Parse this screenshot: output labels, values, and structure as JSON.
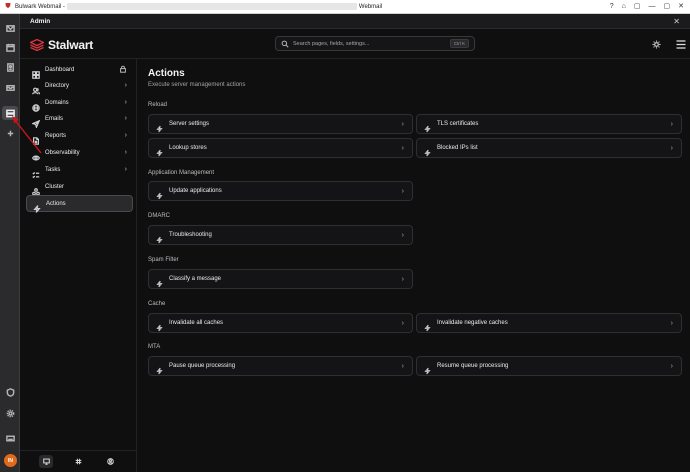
{
  "window": {
    "title_prefix": "Bulwark Webmail -",
    "title_suffix": "Webmail",
    "controls": [
      "?",
      "⌂",
      "▢",
      "—",
      "▢",
      "✕"
    ]
  },
  "admin_bar": {
    "title": "Admin",
    "close": "✕"
  },
  "brand": {
    "name": "Stalwart",
    "color": "#d9363e"
  },
  "search": {
    "placeholder": "Search pages, fields, settings...",
    "shortcut": "Ctrl K"
  },
  "user": {
    "initials": "IN"
  },
  "sidebar": {
    "items": [
      {
        "label": "Dashboard",
        "icon": "dashboard-icon",
        "right": "lock"
      },
      {
        "label": "Directory",
        "icon": "users-icon",
        "right": "›"
      },
      {
        "label": "Domains",
        "icon": "globe-icon",
        "right": "›"
      },
      {
        "label": "Emails",
        "icon": "send-icon",
        "right": "›"
      },
      {
        "label": "Reports",
        "icon": "file-icon",
        "right": "›"
      },
      {
        "label": "Observability",
        "icon": "eye-icon",
        "right": "›"
      },
      {
        "label": "Tasks",
        "icon": "list-check-icon",
        "right": "›"
      },
      {
        "label": "Cluster",
        "icon": "cluster-icon",
        "right": ""
      },
      {
        "label": "Actions",
        "icon": "bolt-icon",
        "right": "",
        "active": true
      }
    ]
  },
  "main": {
    "title": "Actions",
    "subtitle": "Execute server management actions",
    "sections": [
      {
        "title": "Reload",
        "actions": [
          "Server settings",
          "TLS certificates",
          "Lookup stores",
          "Blocked IPs list"
        ]
      },
      {
        "title": "Application Management",
        "actions": [
          "Update applications"
        ]
      },
      {
        "title": "DMARC",
        "actions": [
          "Troubleshooting"
        ]
      },
      {
        "title": "Spam Filter",
        "actions": [
          "Classify a message"
        ]
      },
      {
        "title": "Cache",
        "actions": [
          "Invalidate all caches",
          "Invalidate negative caches"
        ]
      },
      {
        "title": "MTA",
        "actions": [
          "Pause queue processing",
          "Resume queue processing"
        ]
      }
    ],
    "chevron": "›"
  },
  "colors": {
    "accent_arrow": "#c8151b",
    "background": "#0f0f10",
    "avatar": "#e06a1a"
  }
}
